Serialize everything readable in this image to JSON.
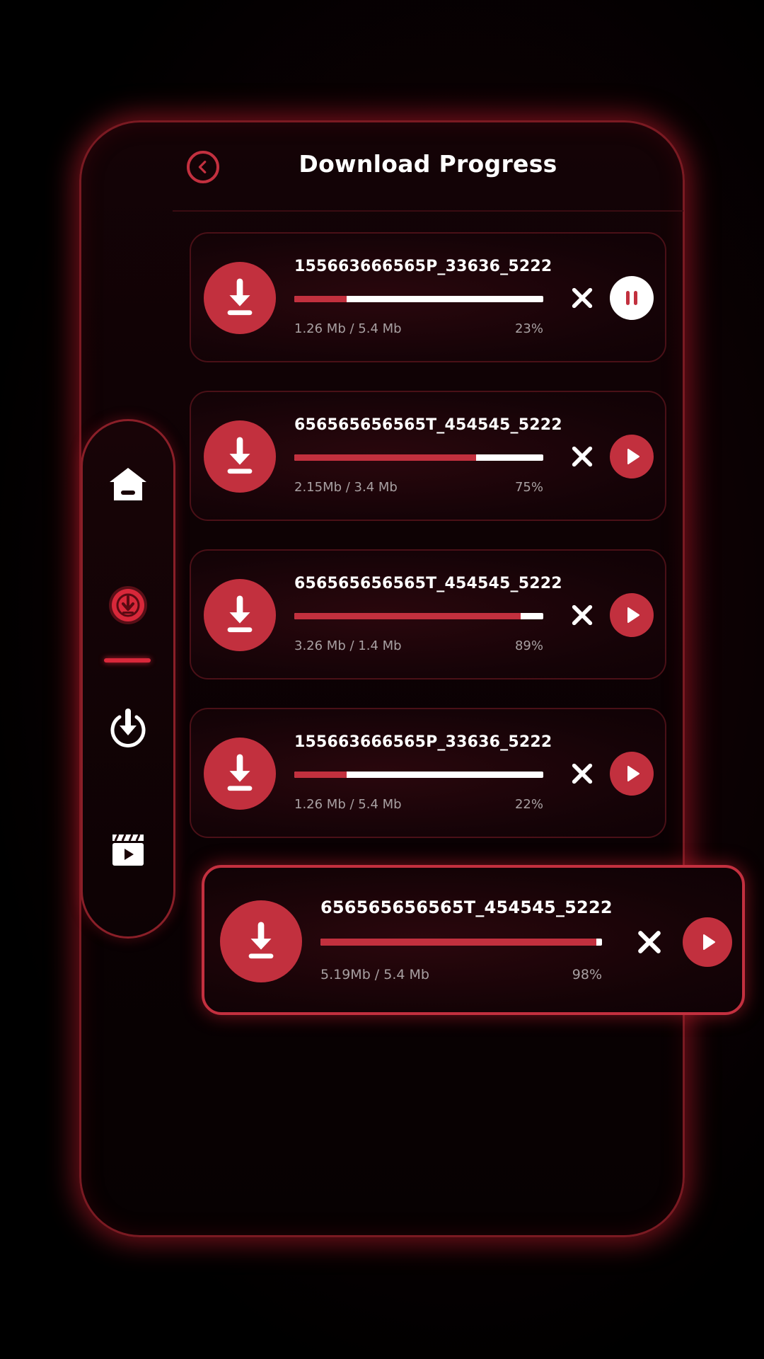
{
  "header": {
    "title": "Download Progress",
    "back_icon": "chevron-left-icon"
  },
  "colors": {
    "accent": "#c2303e",
    "background": "#000000",
    "text": "#ffffff",
    "muted": "#a8a0a2"
  },
  "sidenav": {
    "items": [
      {
        "icon": "home-icon",
        "active": false
      },
      {
        "icon": "download-target-icon",
        "active": true
      },
      {
        "icon": "download-circle-icon",
        "active": false
      },
      {
        "icon": "video-clapper-icon",
        "active": false
      }
    ]
  },
  "downloads": [
    {
      "filename": "155663666565P_33636_5222",
      "size": "1.26 Mb / 5.4 Mb",
      "percent": "23%",
      "progress": 0.21,
      "state": "downloading",
      "action_icon": "pause-icon"
    },
    {
      "filename": "656565656565T_454545_5222",
      "size": "2.15Mb / 3.4 Mb",
      "percent": "75%",
      "progress": 0.73,
      "state": "paused",
      "action_icon": "play-icon"
    },
    {
      "filename": "656565656565T_454545_5222",
      "size": "3.26 Mb / 1.4 Mb",
      "percent": "89%",
      "progress": 0.91,
      "state": "paused",
      "action_icon": "play-icon"
    },
    {
      "filename": "155663666565P_33636_5222",
      "size": "1.26 Mb / 5.4 Mb",
      "percent": "22%",
      "progress": 0.21,
      "state": "paused",
      "action_icon": "play-icon"
    },
    {
      "filename": "656565656565T_454545_5222",
      "size": "5.19Mb / 5.4 Mb",
      "percent": "98%",
      "progress": 0.98,
      "state": "paused",
      "action_icon": "play-icon",
      "highlighted": true
    }
  ]
}
